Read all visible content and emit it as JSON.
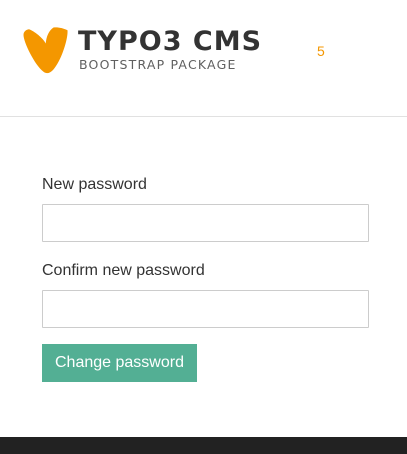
{
  "header": {
    "logo": {
      "title": "TYPO3 CMS",
      "subtitle": "BOOTSTRAP PACKAGE",
      "icon": "typo3-logo-icon",
      "brand_color": "#f49700"
    },
    "counter": "5"
  },
  "form": {
    "new_password_label": "New password",
    "new_password_value": "",
    "confirm_password_label": "Confirm new password",
    "confirm_password_value": "",
    "submit_label": "Change password",
    "submit_color": "#53af94"
  },
  "footer": {
    "background": "#222222"
  }
}
